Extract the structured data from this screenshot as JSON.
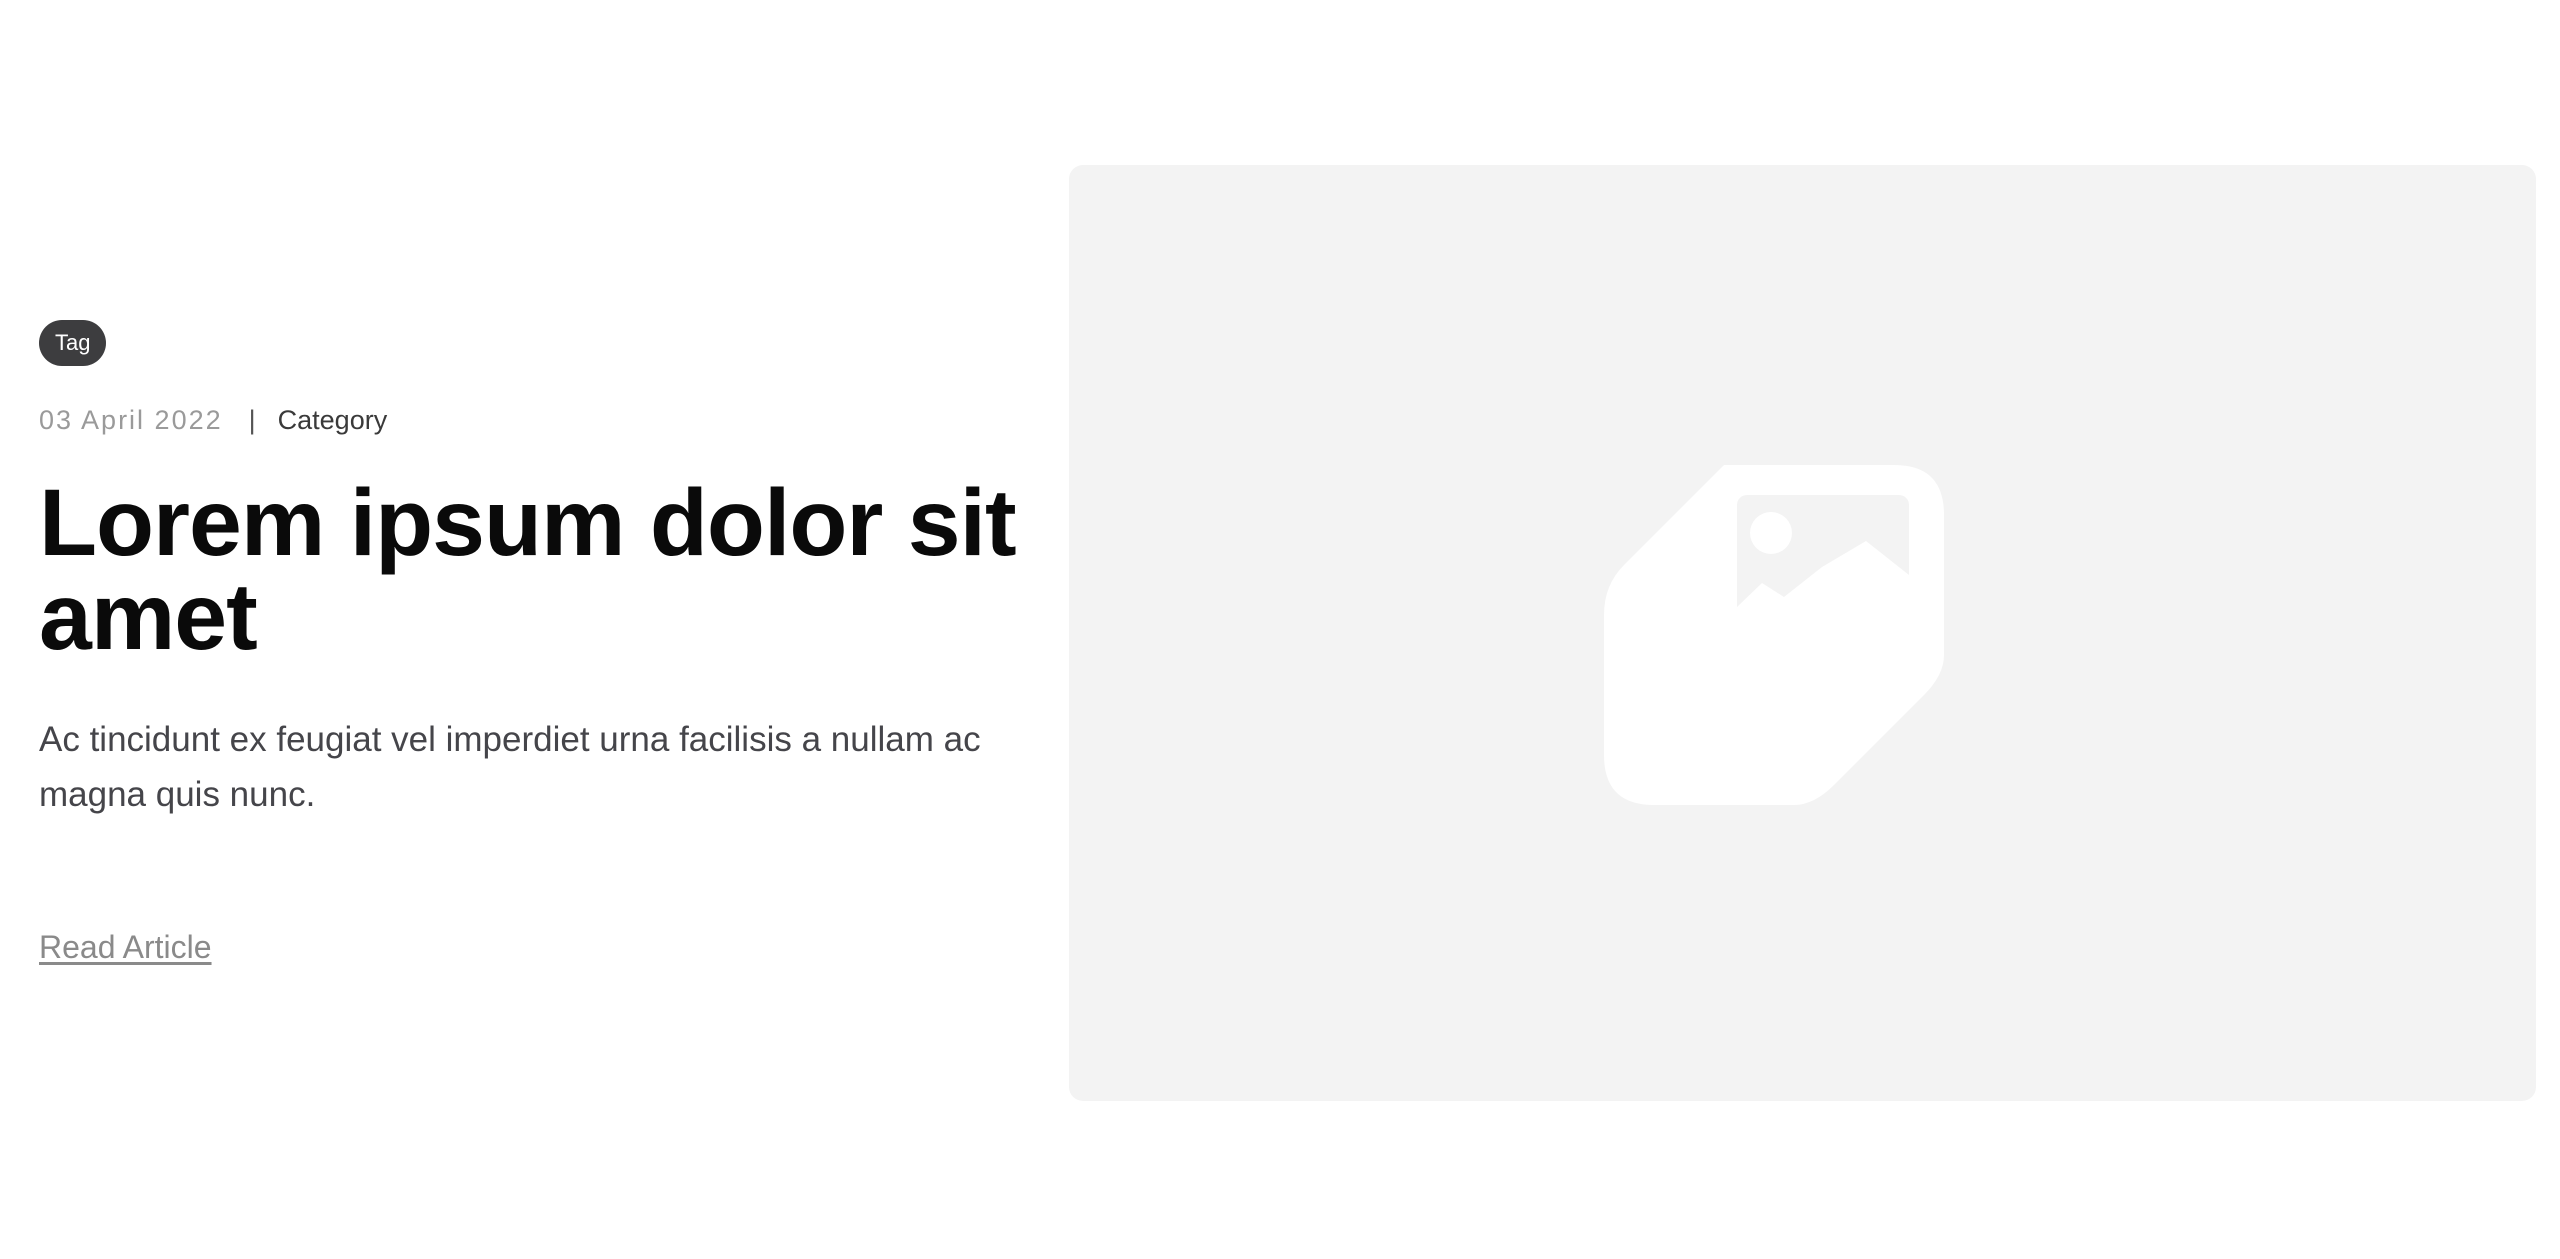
{
  "article": {
    "tag": "Tag",
    "date": "03 April 2022",
    "separator": "|",
    "category": "Category",
    "title": "Lorem ipsum dolor sit amet",
    "description": "Ac tincidunt ex feugiat vel imperdiet urna facilisis a nullam ac magna quis nunc.",
    "read_more_label": "Read Article"
  },
  "image": {
    "icon": "image-placeholder-icon"
  },
  "colors": {
    "tag_background": "#3d3d3f",
    "image_background": "#f3f3f3",
    "title": "#0a0a0a",
    "link": "#8a8a8a"
  }
}
